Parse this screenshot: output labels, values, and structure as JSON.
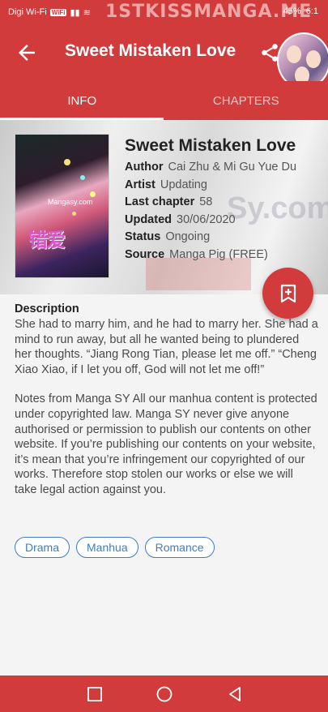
{
  "status": {
    "carrier": "Digi Wi-Fi",
    "wifi_badge": "WiFi",
    "watermark": "1STKISSMANGA.ME",
    "battery": "45%",
    "time": "6:1"
  },
  "header": {
    "title": "Sweet Mistaken Love"
  },
  "tabs": [
    {
      "label": "INFO"
    },
    {
      "label": "CHAPTERS"
    }
  ],
  "manga": {
    "title": "Sweet Mistaken Love",
    "cover_watermark": "Mangasy.com",
    "cover_title": "错爱",
    "background_watermark": "Sy.com",
    "fields": [
      {
        "key": "Author",
        "value": "Cai Zhu & Mi Gu Yue Du"
      },
      {
        "key": "Artist",
        "value": "Updating"
      },
      {
        "key": "Last chapter",
        "value": "58"
      },
      {
        "key": "Updated",
        "value": "30/06/2020"
      },
      {
        "key": "Status",
        "value": "Ongoing"
      },
      {
        "key": "Source",
        "value": "Manga Pig (FREE)"
      }
    ]
  },
  "description": {
    "heading": "Description",
    "paragraphs": [
      "She had to marry him, and he had to marry her. She had a mind to run away, but all he wanted being to plundered her thoughts. “Jiang Rong Tian, please let me off.” “Cheng Xiao Xiao, if I let you off, God will not let me off!”",
      "Notes from Manga SY All our manhua content is protected under copyrighted law. Manga SY never give anyone authorised or permission to publish our contents on other website. If you’re publishing our contents on your website, it’s mean that you’re infringement our copyrighted of our works. Therefore stop stolen our works or else we will take legal action against you."
    ]
  },
  "genres": [
    "Drama",
    "Manhua",
    "Romance"
  ],
  "colors": {
    "primary": "#d23b3b",
    "chip": "#3b7ec9"
  },
  "icons": {
    "back": "arrow-left-icon",
    "share": "share-icon",
    "fab": "bookmark-add-icon",
    "nav": [
      "square-icon",
      "circle-icon",
      "triangle-back-icon"
    ]
  }
}
